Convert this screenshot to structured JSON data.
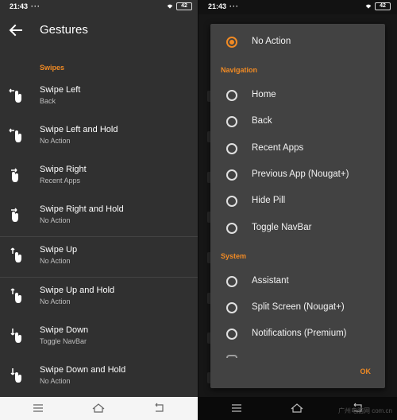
{
  "status": {
    "time": "21:43",
    "dots": "···",
    "battery": "42"
  },
  "left": {
    "title": "Gestures",
    "section": "Swipes",
    "rows": [
      {
        "title": "Swipe Left",
        "sub": "Back"
      },
      {
        "title": "Swipe Left and Hold",
        "sub": "No Action"
      },
      {
        "title": "Swipe Right",
        "sub": "Recent Apps"
      },
      {
        "title": "Swipe Right and Hold",
        "sub": "No Action"
      },
      {
        "title": "Swipe Up",
        "sub": "No Action"
      },
      {
        "title": "Swipe Up and Hold",
        "sub": "No Action"
      },
      {
        "title": "Swipe Down",
        "sub": "Toggle NavBar"
      },
      {
        "title": "Swipe Down and Hold",
        "sub": "No Action"
      }
    ]
  },
  "dialog": {
    "selected": "No Action",
    "options_top": [
      "No Action"
    ],
    "section_navigation": "Navigation",
    "navigation": [
      "Home",
      "Back",
      "Recent Apps",
      "Previous App (Nougat+)",
      "Hide Pill",
      "Toggle NavBar"
    ],
    "section_system": "System",
    "system": [
      "Assistant",
      "Split Screen (Nougat+)",
      "Notifications (Premium)"
    ],
    "ok": "OK"
  },
  "watermark": "广州电脑网 com.cn",
  "colors": {
    "accent": "#f08a24",
    "background": "#303030",
    "dialog": "#424242",
    "navbar_light": "#f5f5f5",
    "navbar_dark": "#0a0a0a"
  },
  "icons": [
    "back-arrow-icon",
    "swipe-gesture-icon",
    "wifi-icon",
    "battery-icon",
    "menu-icon",
    "home-icon",
    "return-icon"
  ]
}
